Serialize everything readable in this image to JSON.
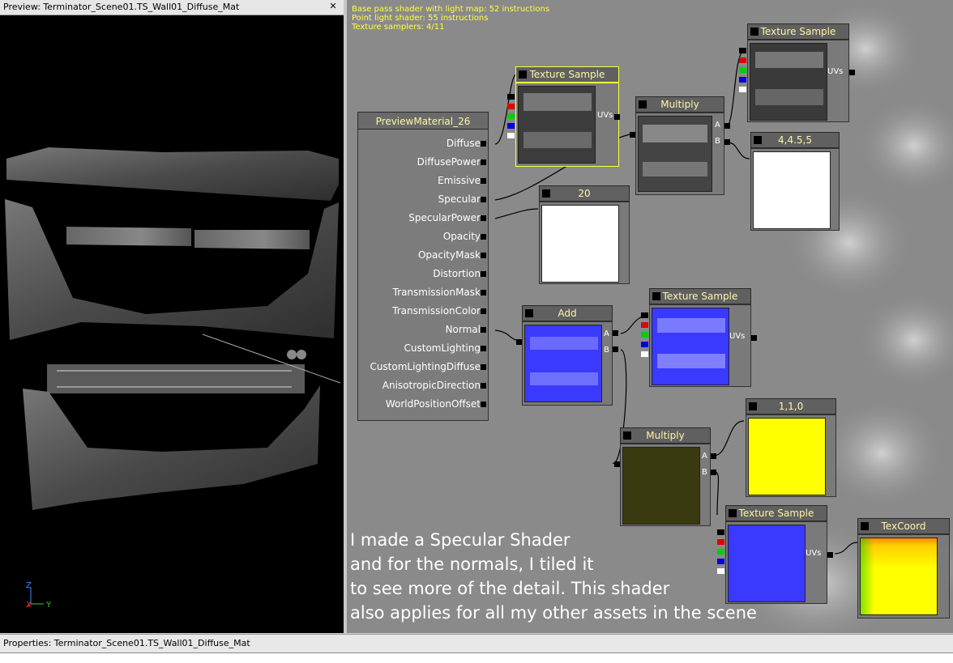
{
  "preview": {
    "title": "Preview: Terminator_Scene01.TS_Wall01_Diffuse_Mat",
    "close_glyph": "✕",
    "axis": {
      "z": "Z",
      "x": "X",
      "y": "Y"
    }
  },
  "stats": [
    "Base pass shader with light map: 52 instructions",
    "Point light shader: 55 instructions",
    "Texture samplers: 4/11"
  ],
  "material_node": {
    "title": "PreviewMaterial_26",
    "inputs": [
      "Diffuse",
      "DiffusePower",
      "Emissive",
      "Specular",
      "SpecularPower",
      "Opacity",
      "OpacityMask",
      "Distortion",
      "TransmissionMask",
      "TransmissionColor",
      "Normal",
      "CustomLighting",
      "CustomLightingDiffuse",
      "AnisotropicDirection",
      "WorldPositionOffset"
    ]
  },
  "nodes": {
    "tex_diffuse": {
      "title": "Texture Sample",
      "uvs": "UVs"
    },
    "multiply_top": {
      "title": "Multiply",
      "a": "A",
      "b": "B"
    },
    "tex_top": {
      "title": "Texture Sample",
      "uvs": "UVs"
    },
    "const_445": {
      "title": "4,4.5,5"
    },
    "const_20": {
      "title": "20"
    },
    "add": {
      "title": "Add",
      "a": "A",
      "b": "B"
    },
    "tex_normal": {
      "title": "Texture Sample",
      "uvs": "UVs"
    },
    "const_110": {
      "title": "1,1,0"
    },
    "multiply_bottom": {
      "title": "Multiply",
      "a": "A",
      "b": "B"
    },
    "tex_normal2": {
      "title": "Texture Sample",
      "uvs": "UVs"
    },
    "texcoord": {
      "title": "TexCoord"
    }
  },
  "caption": [
    "I made a Specular Shader",
    "and for the normals, I tiled it",
    "to see more of the detail. This shader",
    "also applies for all my other assets in the scene"
  ],
  "properties": {
    "title": "Properties: Terminator_Scene01.TS_Wall01_Diffuse_Mat"
  },
  "colors": {
    "canvas_bg": "#8a8a8a",
    "node_title_text": "#fff5a8",
    "selected_border": "#ffff40",
    "normal_blue": "#3a3aff",
    "const_yellow": "#ffff00",
    "multiply_dark": "#3a3a10"
  }
}
